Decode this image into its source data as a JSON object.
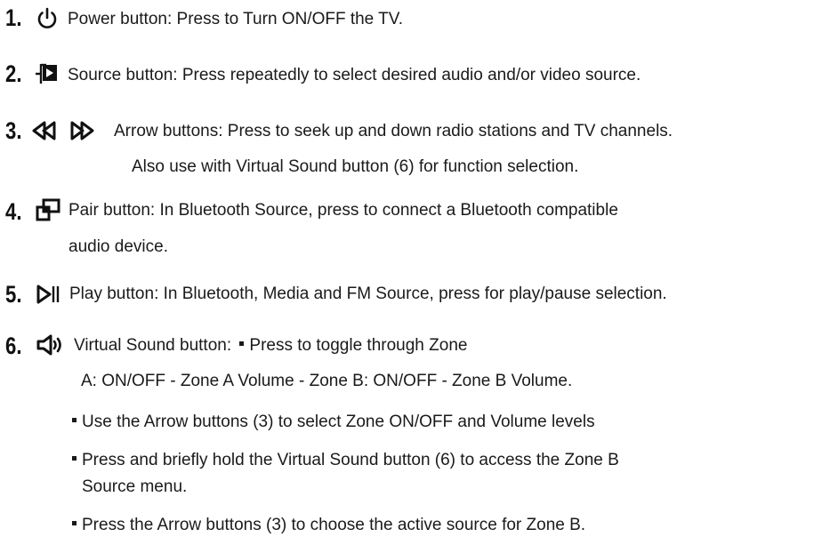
{
  "items": [
    {
      "number": "1.",
      "icon": "power-icon",
      "text": "Power button: Press to Turn ON/OFF the TV."
    },
    {
      "number": "2.",
      "icon": "source-icon",
      "text": "Source button: Press repeatedly to select desired audio and/or video source."
    },
    {
      "number": "3.",
      "icon": "arrow-buttons-icon",
      "text": "Arrow buttons: Press to seek up and down radio stations and TV channels.",
      "continuation": "Also use with Virtual Sound button (6) for function selection."
    },
    {
      "number": "4.",
      "icon": "pair-icon",
      "text": "Pair button: In Bluetooth Source, press to connect a Bluetooth compatible",
      "continuation": "audio device."
    },
    {
      "number": "5.",
      "icon": "play-pause-icon",
      "text": "Play button: In Bluetooth, Media and FM Source, press for play/pause selection."
    },
    {
      "number": "6.",
      "icon": "virtual-sound-icon",
      "text": "Virtual Sound button:",
      "bullet_inline": "Press to toggle through Zone",
      "continuation": "A: ON/OFF - Zone A Volume - Zone B: ON/OFF - Zone B Volume.",
      "bullets": [
        "Use the Arrow buttons (3) to select Zone ON/OFF and Volume levels",
        "Press and briefly hold the Virtual Sound button (6) to access the Zone B",
        "Press the Arrow buttons (3) to choose the active source for Zone B."
      ],
      "bullet2_continuation": "Source menu."
    }
  ]
}
